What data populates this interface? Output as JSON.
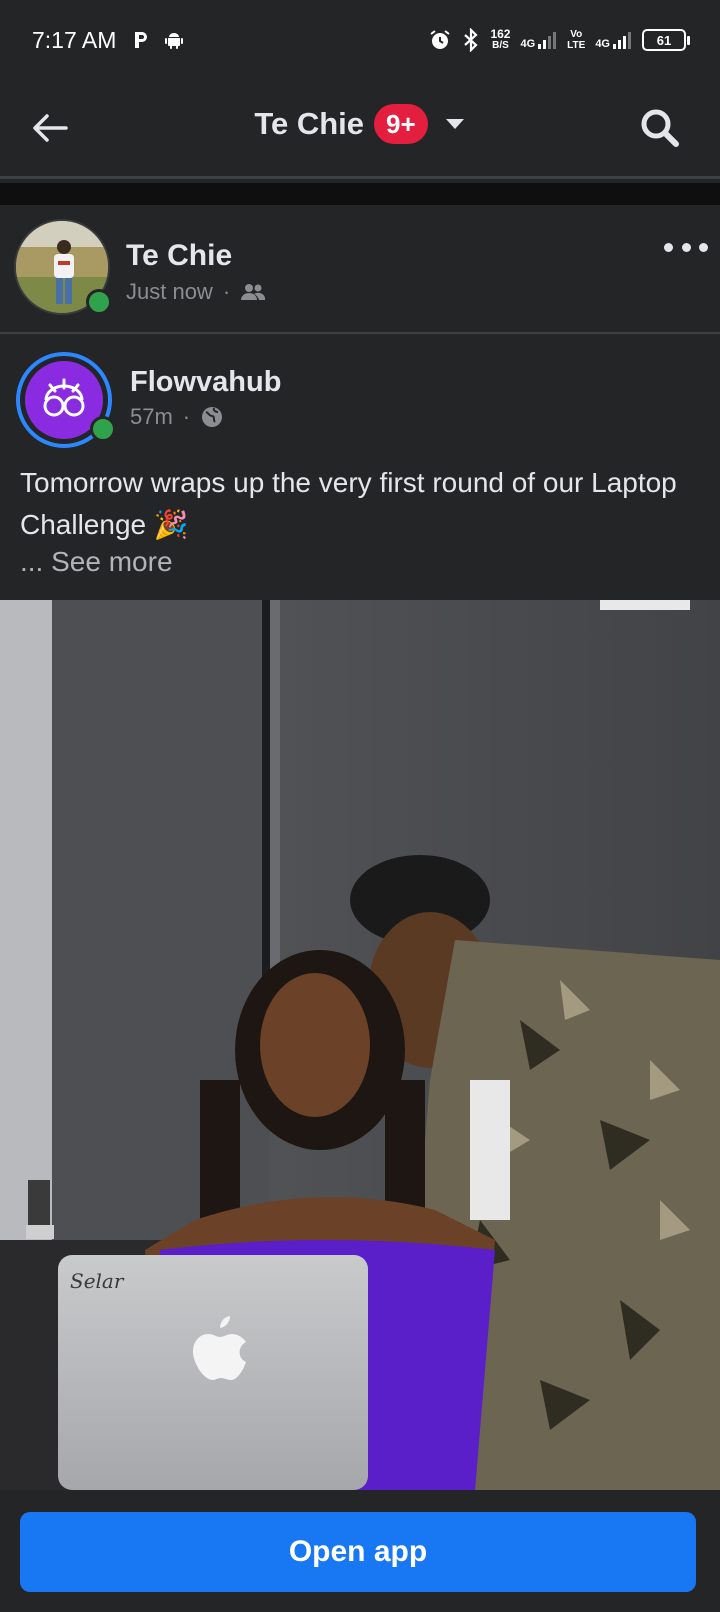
{
  "status_bar": {
    "time": "7:17 AM",
    "net_speed_top": "162",
    "net_speed_bottom": "B/S",
    "net_type_1": "4G",
    "volte_top": "Vo",
    "volte_bottom": "LTE",
    "net_type_2": "4G",
    "battery": "61"
  },
  "header": {
    "title": "Te Chie",
    "badge": "9+"
  },
  "post": {
    "author": "Te Chie",
    "time": "Just now",
    "separator": "·",
    "privacy_icon": "friends-icon"
  },
  "shared_post": {
    "author": "Flowvahub",
    "time": "57m",
    "separator": "·",
    "privacy_icon": "globe-icon",
    "text": "Tomorrow wraps up the very first round of our Laptop Challenge 🎉",
    "see_more": "... See more",
    "laptop_sticker": "Selar"
  },
  "bottom": {
    "open_app_label": "Open app"
  },
  "colors": {
    "background": "#242526",
    "accent": "#1877f2",
    "badge": "#e41e3f",
    "online": "#31a24c"
  }
}
